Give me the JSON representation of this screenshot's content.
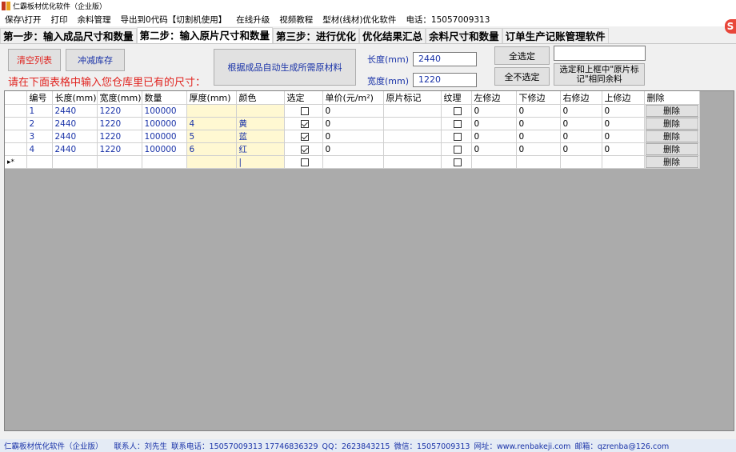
{
  "window": {
    "title": "仁霸板材优化软件（企业版）"
  },
  "menu": {
    "items": [
      "保存\\打开",
      "打印",
      "余料管理",
      "导出到0代码【切割机使用】",
      "在线升级",
      "视频教程",
      "型材(线材)优化软件"
    ],
    "phone": "电话：15057009313"
  },
  "tabs": [
    "第一步：输入成品尺寸和数量",
    "第二步：输入原片尺寸和数量",
    "第三步：进行优化",
    "优化结果汇总",
    "余料尺寸和数量",
    "订单生产记账管理软件"
  ],
  "toolbar": {
    "clear_label": "清空列表",
    "reduce_stock_label": "冲减库存",
    "generate_label": "根据成品自动生成所需原材料",
    "length_label": "长度(mm)",
    "length_value": "2440",
    "width_label": "宽度(mm)",
    "width_value": "1220",
    "select_all_label": "全选定",
    "deselect_all_label": "全不选定",
    "mark_value": "",
    "select_mark_label": "选定和上框中\"原片标记\"相同余料"
  },
  "notice": "请在下面表格中输入您仓库里已有的尺寸：",
  "table": {
    "headers": [
      "编号",
      "长度(mm)",
      "宽度(mm)",
      "数量",
      "厚度(mm)",
      "颜色",
      "选定",
      "单价(元/m²)",
      "原片标记",
      "纹理",
      "左修边",
      "下修边",
      "右修边",
      "上修边",
      "删除"
    ],
    "rows": [
      {
        "id": "1",
        "length": "2440",
        "width": "1220",
        "qty": "100000",
        "thickness": "",
        "color": "",
        "selected": false,
        "price": "0",
        "mark": "",
        "grain": false,
        "left": "0",
        "bottom": "0",
        "right": "0",
        "top": "0",
        "delete": "删除"
      },
      {
        "id": "2",
        "length": "2440",
        "width": "1220",
        "qty": "100000",
        "thickness": "4",
        "color": "黄",
        "selected": true,
        "price": "0",
        "mark": "",
        "grain": false,
        "left": "0",
        "bottom": "0",
        "right": "0",
        "top": "0",
        "delete": "删除"
      },
      {
        "id": "3",
        "length": "2440",
        "width": "1220",
        "qty": "100000",
        "thickness": "5",
        "color": "蓝",
        "selected": true,
        "price": "0",
        "mark": "",
        "grain": false,
        "left": "0",
        "bottom": "0",
        "right": "0",
        "top": "0",
        "delete": "删除"
      },
      {
        "id": "4",
        "length": "2440",
        "width": "1220",
        "qty": "100000",
        "thickness": "6",
        "color": "红",
        "selected": true,
        "price": "0",
        "mark": "",
        "grain": false,
        "left": "0",
        "bottom": "0",
        "right": "0",
        "top": "0",
        "delete": "删除"
      }
    ],
    "new_row_marker": "▸*",
    "new_row_delete": "删除"
  },
  "statusbar": {
    "app": "仁霸板材优化软件（企业版）",
    "contact": "联系人：刘先生",
    "phone": "联系电话：15057009313 17746836329",
    "qq": "QQ：2623843215",
    "wechat": "微信：15057009313",
    "website": "网址：www.renbakeji.com",
    "email": "邮箱：qzrenba@126.com"
  }
}
